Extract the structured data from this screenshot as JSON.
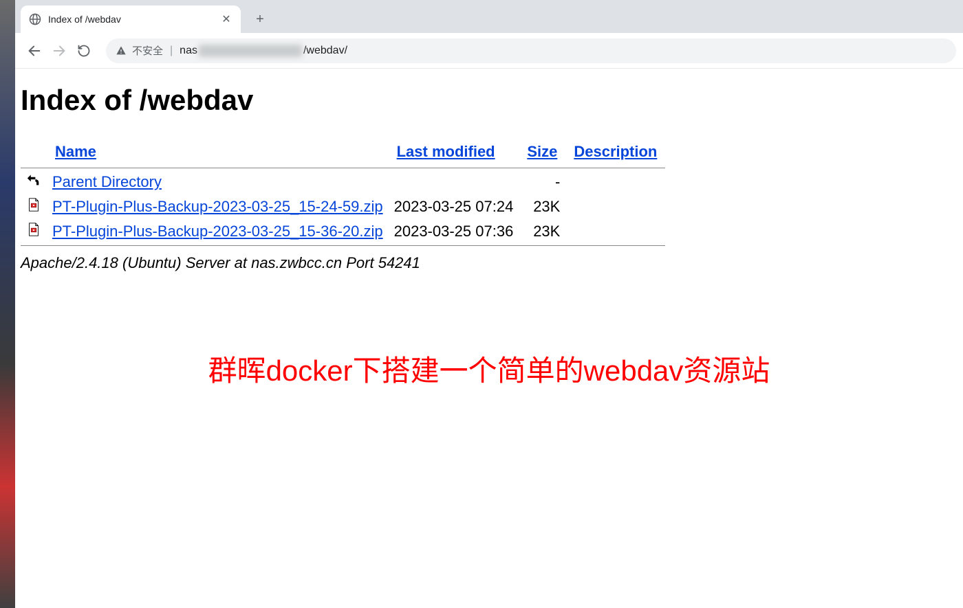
{
  "tab": {
    "title": "Index of /webdav",
    "close_glyph": "✕",
    "new_tab_glyph": "+"
  },
  "toolbar": {
    "security_label": "不安全",
    "url_prefix": "nas",
    "url_suffix": "/webdav/"
  },
  "page": {
    "title": "Index of /webdav",
    "headers": {
      "name": "Name",
      "last_modified": "Last modified",
      "size": "Size",
      "description": "Description"
    },
    "parent_dir": {
      "label": "Parent Directory",
      "size": "-"
    },
    "rows": [
      {
        "name": "PT-Plugin-Plus-Backup-2023-03-25_15-24-59.zip",
        "last_modified": "2023-03-25 07:24",
        "size": "23K"
      },
      {
        "name": "PT-Plugin-Plus-Backup-2023-03-25_15-36-20.zip",
        "last_modified": "2023-03-25 07:36",
        "size": "23K"
      }
    ],
    "footer": "Apache/2.4.18 (Ubuntu) Server at nas.zwbcc.cn Port 54241"
  },
  "overlay_caption": "群晖docker下搭建一个简单的webdav资源站"
}
